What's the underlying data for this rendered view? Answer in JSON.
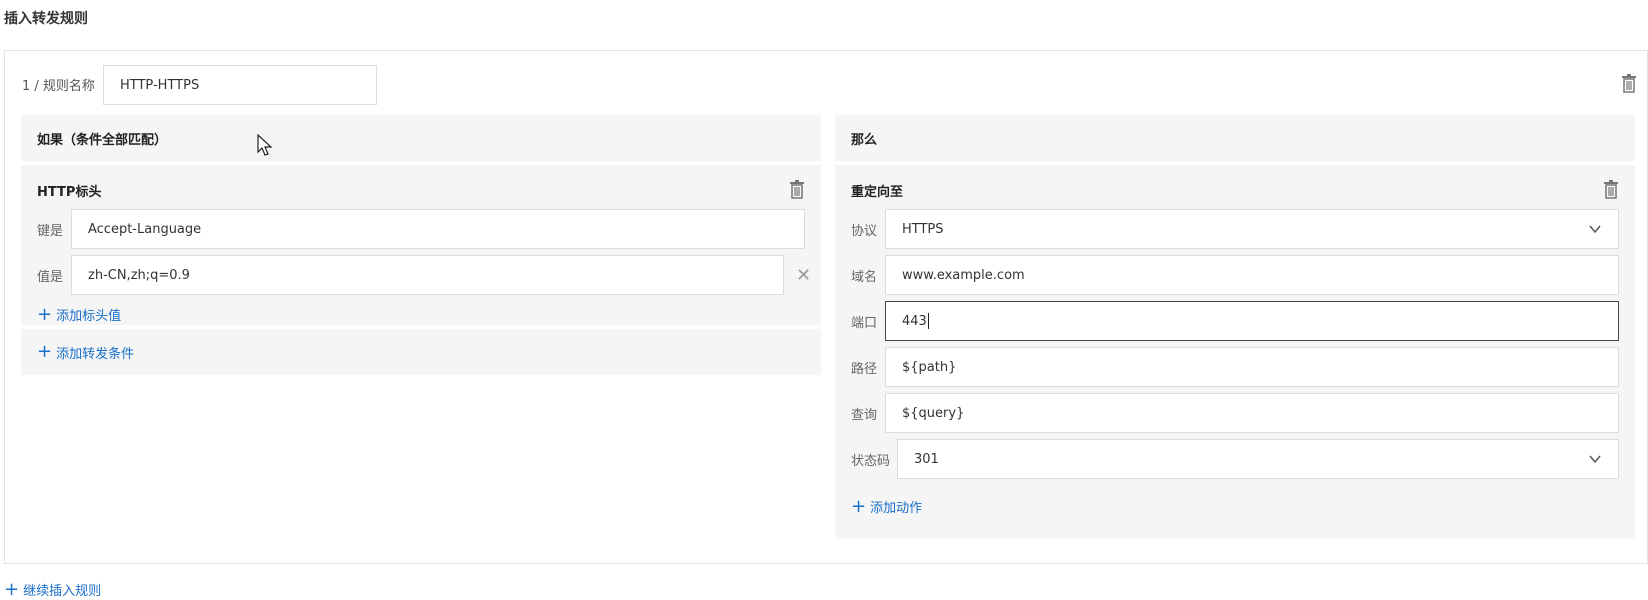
{
  "page": {
    "title": "插入转发规则"
  },
  "rule": {
    "index_label": "1 / 规则名称",
    "name_value": "HTTP-HTTPS"
  },
  "if_panel": {
    "header": "如果（条件全部匹配）",
    "condition": {
      "title": "HTTP标头",
      "key_label": "键是",
      "key_value": "Accept-Language",
      "value_label": "值是",
      "value_value": "zh-CN,zh;q=0.9",
      "add_value_label": "添加标头值"
    },
    "add_condition_label": "添加转发条件"
  },
  "then_panel": {
    "header": "那么",
    "action": {
      "title": "重定向至",
      "protocol_label": "协议",
      "protocol_value": "HTTPS",
      "domain_label": "域名",
      "domain_value": "www.example.com",
      "port_label": "端口",
      "port_value": "443",
      "path_label": "路径",
      "path_value": "${path}",
      "query_label": "查询",
      "query_value": "${query}",
      "status_label": "状态码",
      "status_value": "301"
    },
    "add_action_label": "添加动作"
  },
  "footer": {
    "add_rule_label": "继续插入规则"
  },
  "icons": {
    "delete": "trash-icon",
    "clear": "close-icon",
    "dropdown": "chevron-down-icon",
    "add": "plus-icon"
  },
  "colors": {
    "link": "#1a6fc9",
    "panel_bg": "#f5f5f5",
    "border": "#dcdcdc"
  }
}
